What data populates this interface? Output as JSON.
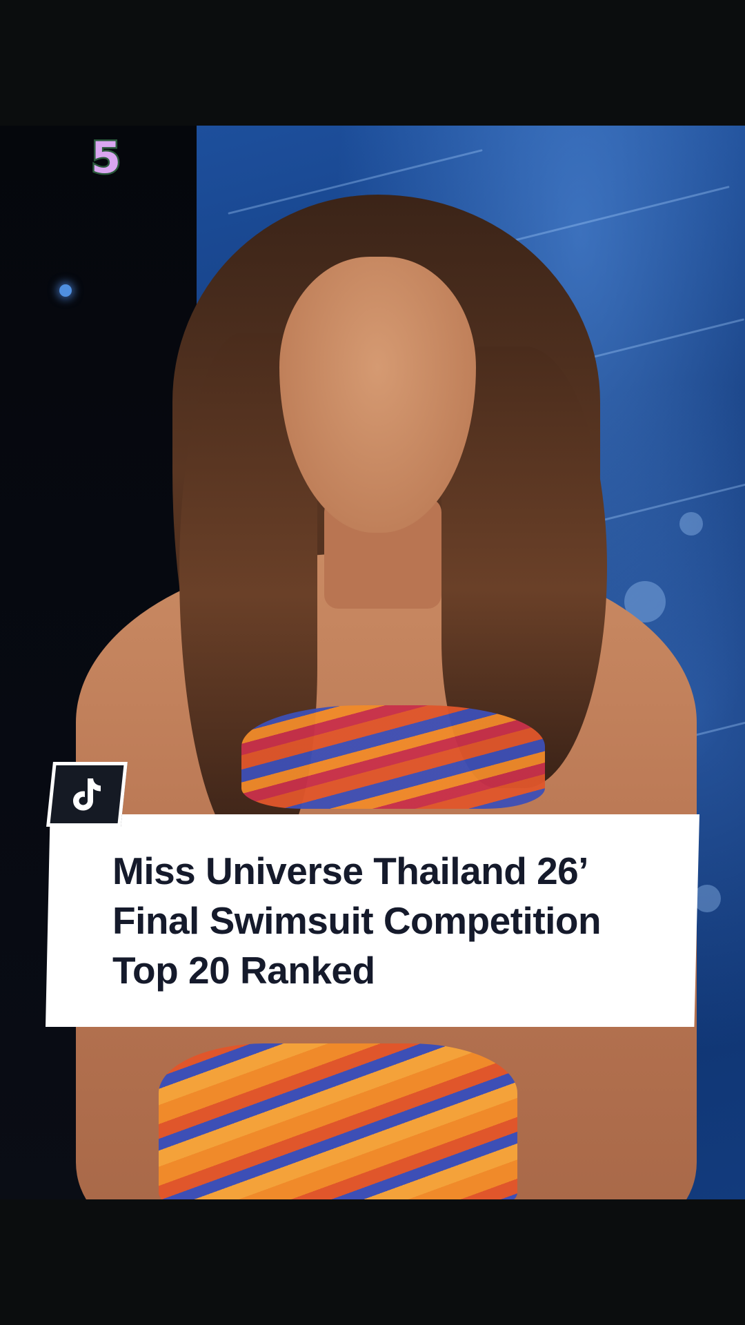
{
  "overlay": {
    "rank_number": "5",
    "caption": {
      "line1": "Miss Universe Thailand 26’",
      "line2": "Final Swimsuit Competition",
      "line3": "Top 20 Ranked"
    },
    "logo": {
      "icon": "tiktok-logo-icon"
    }
  },
  "colors": {
    "background": "#0a0c0d",
    "caption_card": "#ffffff",
    "caption_text": "#151a2b",
    "rank_fill": "#d9a6f0",
    "rank_outline": "#2b5a3c",
    "logo_box": "#151a24",
    "stage_screen": "#12397a"
  }
}
